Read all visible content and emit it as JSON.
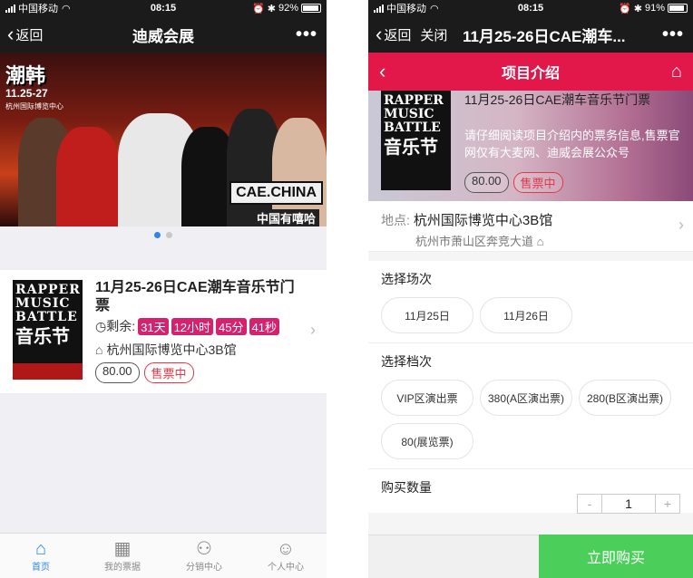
{
  "left": {
    "status": {
      "carrier": "中国移动",
      "time": "08:15",
      "battery": "92%",
      "battery_level": 0.92
    },
    "nav": {
      "back": "返回",
      "title": "迪威会展",
      "more": "•••"
    },
    "banner": {
      "title": "潮韩",
      "date": "11.25-27",
      "venue": "杭州国际博览中心",
      "logo": "CAE.CHINA",
      "logo_sub": "中国有嘻哈"
    },
    "product": {
      "poster_line1": "RAPPER MUSIC BATTLE",
      "poster_line2": "音乐节",
      "name": "11月25-26日CAE潮车音乐节门票",
      "countdown_label": "剩余:",
      "days": "31天",
      "hours": "12小时",
      "minutes": "45分",
      "seconds": "41秒",
      "venue": "杭州国际博览中心3B馆",
      "price": "80.00",
      "status": "售票中"
    },
    "tabs": [
      {
        "label": "首页",
        "icon": "home-icon"
      },
      {
        "label": "我的票据",
        "icon": "qrcode-icon"
      },
      {
        "label": "分销中心",
        "icon": "users-icon"
      },
      {
        "label": "个人中心",
        "icon": "user-icon"
      }
    ]
  },
  "right": {
    "status": {
      "carrier": "中国移动",
      "time": "08:15",
      "battery": "91%",
      "battery_level": 0.91
    },
    "nav": {
      "back": "返回",
      "close": "关闭",
      "title": "11月25-26日CAE潮车...",
      "more": "•••"
    },
    "header": {
      "title": "项目介绍"
    },
    "hero": {
      "name": "11月25-26日CAE潮车音乐节门票",
      "desc": "请仔细阅读项目介绍内的票务信息,售票官网仅有大麦网、迪威会展公众号",
      "price": "80.00",
      "status": "售票中"
    },
    "address": {
      "label": "地点:",
      "name": "杭州国际博览中心3B馆",
      "detail": "杭州市萧山区奔竞大道"
    },
    "session": {
      "title": "选择场次",
      "options": [
        "11月25日",
        "11月26日"
      ]
    },
    "tier": {
      "title": "选择档次",
      "options": [
        "VIP区演出票",
        "380(A区演出票)",
        "280(B区演出票)",
        "80(展览票)"
      ]
    },
    "quantity": {
      "title": "购买数量",
      "minus": "-",
      "value": "1",
      "plus": "+"
    },
    "buy": "立即购买"
  }
}
